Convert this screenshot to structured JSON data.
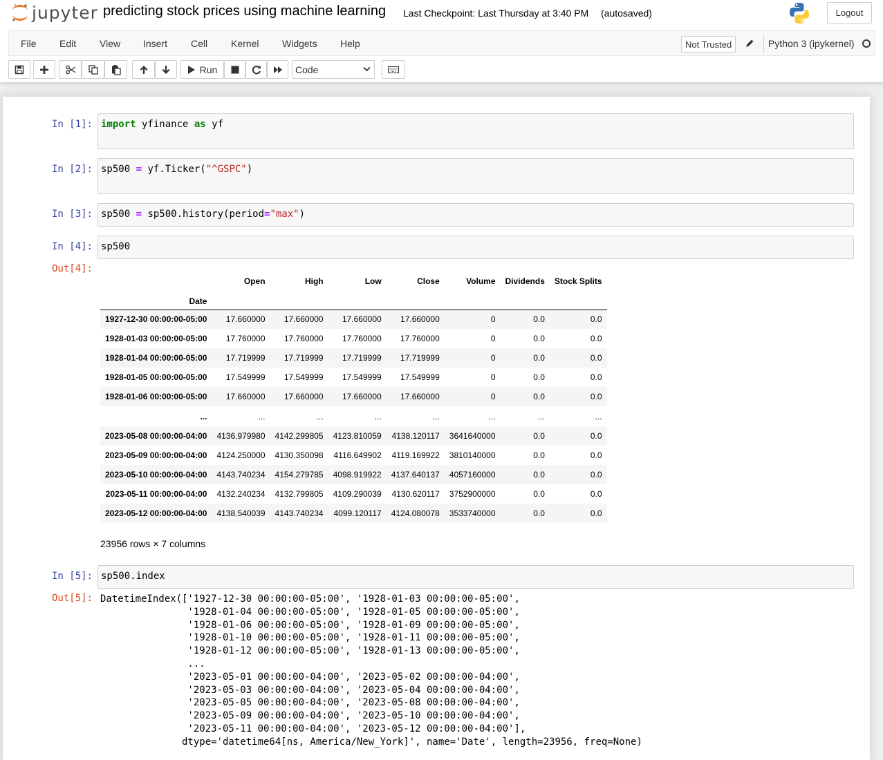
{
  "header": {
    "brand": "jupyter",
    "notebook_title": "predicting stock prices using machine learning",
    "checkpoint": "Last Checkpoint: Last Thursday at 3:40 PM",
    "autosave": "(autosaved)",
    "logout_label": "Logout"
  },
  "menu": {
    "items": [
      "File",
      "Edit",
      "View",
      "Insert",
      "Cell",
      "Kernel",
      "Widgets",
      "Help"
    ],
    "trust_label": "Not Trusted",
    "kernel_name": "Python 3 (ipykernel)"
  },
  "toolbar": {
    "run_label": "Run",
    "cell_type": "Code",
    "icons": [
      "save-icon",
      "plus-icon",
      "cut-icon",
      "copy-icon",
      "paste-icon",
      "arrow-up-icon",
      "arrow-down-icon",
      "play-icon",
      "stop-icon",
      "restart-icon",
      "fast-forward-icon",
      "keyboard-icon"
    ]
  },
  "cells": {
    "c1": {
      "prompt": "In [1]:",
      "kw1": "import",
      "mid": " yfinance ",
      "kw2": "as",
      "tail": " yf"
    },
    "c2": {
      "prompt": "In [2]:",
      "a": "sp500 ",
      "op": "=",
      "b": " yf.Ticker(",
      "s": "\"^GSPC\"",
      "c": ")"
    },
    "c3": {
      "prompt": "In [3]:",
      "a": "sp500 ",
      "op": "=",
      "b": " sp500.history(period",
      "op2": "=",
      "s": "\"max\"",
      "c": ")"
    },
    "c4": {
      "prompt": "In [4]:",
      "code": "sp500",
      "out_prompt": "Out[4]:"
    },
    "c5": {
      "prompt": "In [5]:",
      "code": "sp500.index",
      "out_prompt": "Out[5]:"
    }
  },
  "dataframe": {
    "columns": [
      "Open",
      "High",
      "Low",
      "Close",
      "Volume",
      "Dividends",
      "Stock Splits"
    ],
    "index_name": "Date",
    "rows": [
      {
        "date": "1927-12-30 00:00:00-05:00",
        "v": [
          "17.660000",
          "17.660000",
          "17.660000",
          "17.660000",
          "0",
          "0.0",
          "0.0"
        ]
      },
      {
        "date": "1928-01-03 00:00:00-05:00",
        "v": [
          "17.760000",
          "17.760000",
          "17.760000",
          "17.760000",
          "0",
          "0.0",
          "0.0"
        ]
      },
      {
        "date": "1928-01-04 00:00:00-05:00",
        "v": [
          "17.719999",
          "17.719999",
          "17.719999",
          "17.719999",
          "0",
          "0.0",
          "0.0"
        ]
      },
      {
        "date": "1928-01-05 00:00:00-05:00",
        "v": [
          "17.549999",
          "17.549999",
          "17.549999",
          "17.549999",
          "0",
          "0.0",
          "0.0"
        ]
      },
      {
        "date": "1928-01-06 00:00:00-05:00",
        "v": [
          "17.660000",
          "17.660000",
          "17.660000",
          "17.660000",
          "0",
          "0.0",
          "0.0"
        ]
      },
      {
        "date": "...",
        "v": [
          "...",
          "...",
          "...",
          "...",
          "...",
          "...",
          "..."
        ]
      },
      {
        "date": "2023-05-08 00:00:00-04:00",
        "v": [
          "4136.979980",
          "4142.299805",
          "4123.810059",
          "4138.120117",
          "3641640000",
          "0.0",
          "0.0"
        ]
      },
      {
        "date": "2023-05-09 00:00:00-04:00",
        "v": [
          "4124.250000",
          "4130.350098",
          "4116.649902",
          "4119.169922",
          "3810140000",
          "0.0",
          "0.0"
        ]
      },
      {
        "date": "2023-05-10 00:00:00-04:00",
        "v": [
          "4143.740234",
          "4154.279785",
          "4098.919922",
          "4137.640137",
          "4057160000",
          "0.0",
          "0.0"
        ]
      },
      {
        "date": "2023-05-11 00:00:00-04:00",
        "v": [
          "4132.240234",
          "4132.799805",
          "4109.290039",
          "4130.620117",
          "3752900000",
          "0.0",
          "0.0"
        ]
      },
      {
        "date": "2023-05-12 00:00:00-04:00",
        "v": [
          "4138.540039",
          "4143.740234",
          "4099.120117",
          "4124.080078",
          "3533740000",
          "0.0",
          "0.0"
        ]
      }
    ],
    "shape_text": "23956 rows × 7 columns"
  },
  "index_output": [
    "DatetimeIndex(['1927-12-30 00:00:00-05:00', '1928-01-03 00:00:00-05:00',",
    "               '1928-01-04 00:00:00-05:00', '1928-01-05 00:00:00-05:00',",
    "               '1928-01-06 00:00:00-05:00', '1928-01-09 00:00:00-05:00',",
    "               '1928-01-10 00:00:00-05:00', '1928-01-11 00:00:00-05:00',",
    "               '1928-01-12 00:00:00-05:00', '1928-01-13 00:00:00-05:00',",
    "               ...",
    "               '2023-05-01 00:00:00-04:00', '2023-05-02 00:00:00-04:00',",
    "               '2023-05-03 00:00:00-04:00', '2023-05-04 00:00:00-04:00',",
    "               '2023-05-05 00:00:00-04:00', '2023-05-08 00:00:00-04:00',",
    "               '2023-05-09 00:00:00-04:00', '2023-05-10 00:00:00-04:00',",
    "               '2023-05-11 00:00:00-04:00', '2023-05-12 00:00:00-04:00'],",
    "              dtype='datetime64[ns, America/New_York]', name='Date', length=23956, freq=None)"
  ]
}
